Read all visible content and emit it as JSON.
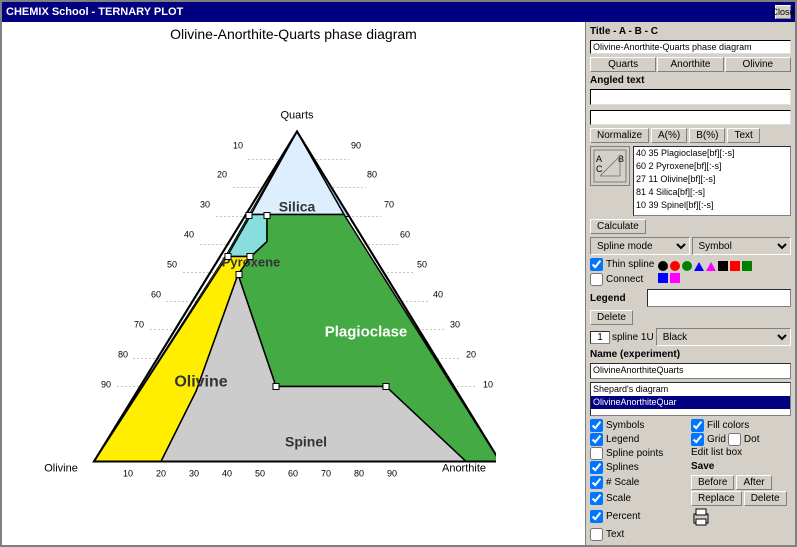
{
  "window": {
    "title": "CHEMIX School - TERNARY PLOT",
    "close_btn": "Close"
  },
  "plot": {
    "title": "Olivine-Anorthite-Quarts phase diagram",
    "vertices": {
      "top": "Quarts",
      "bottom_left": "Olivine",
      "bottom_right": "Anorthite"
    },
    "regions": [
      "Silica",
      "Pyroxene",
      "Olivine",
      "Plagioclase",
      "Spinel"
    ],
    "axis_ticks": [
      10,
      20,
      30,
      40,
      50,
      60,
      70,
      80,
      90
    ]
  },
  "right_panel": {
    "title_label": "Title - A - B - C",
    "title_value": "Olivine-Anorthite-Quarts phase diagram",
    "abc_buttons": [
      "Quarts",
      "Anorthite",
      "Olivine"
    ],
    "angled_text_label": "Angled text",
    "normalize_btn": "Normalize",
    "a_pct_btn": "A(%)",
    "b_pct_btn": "B(%)",
    "text_btn": "Text",
    "spline_data": [
      "40 35 Plagioclase[bf][:-s]",
      "60 2 Pyroxene[bf][:-s]",
      "27 11 Olivine[bf][:-s]",
      "81 4 Silica[bf][:-s]",
      "10 39 Spinel[bf][:-s]"
    ],
    "calculate_btn": "Calculate",
    "spline_mode_label": "Spline mode",
    "symbol_label": "Symbol",
    "thin_spline_label": "Thin spline",
    "connect_label": "Connect",
    "delete_btn": "Delete",
    "spline_number": "1",
    "spline_label": "spline 1U",
    "color_label": "Black",
    "legend_label": "Legend",
    "legend_value": "",
    "name_label": "Name (experiment)",
    "name_value": "OlivineAnorthiteQuarts",
    "small_list_items": [
      "Shepard's diagram",
      "OlivineAnorthiteQuar"
    ],
    "fill_colors_label": "Fill colors",
    "checkboxes": {
      "symbols": "Symbols",
      "legend": "Legend",
      "fill_colors": "Fill colors",
      "grid": "Grid",
      "dot": "Dot",
      "spline_points": "Spline points",
      "splines": "Splines",
      "num_scale": "# Scale",
      "scale": "Scale",
      "percent": "Percent",
      "text": "Text"
    },
    "edit_list_box_label": "Edit list box",
    "save_label": "Save",
    "before_btn": "Before",
    "after_btn": "After",
    "replace_btn": "Replace",
    "delete_btn2": "Delete"
  }
}
